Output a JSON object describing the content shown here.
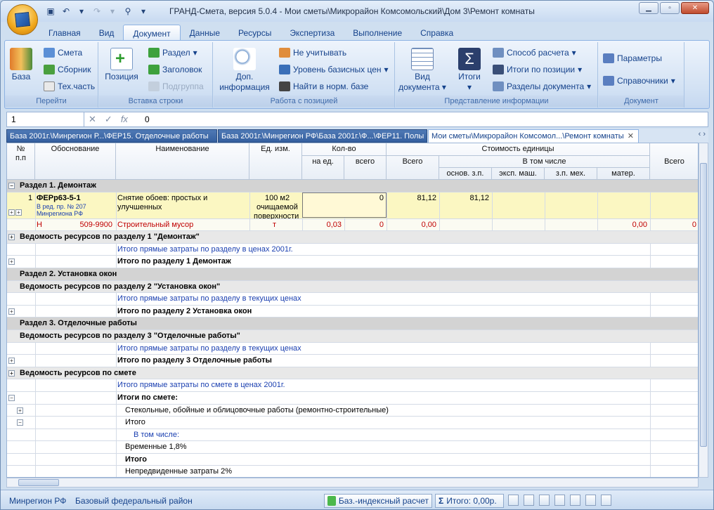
{
  "app": {
    "title": "ГРАНД-Смета, версия 5.0.4 - Мои сметы\\Микрорайон Комсомольский\\Дом 3\\Ремонт комнаты"
  },
  "ribbon_tabs": [
    "Главная",
    "Вид",
    "Документ",
    "Данные",
    "Ресурсы",
    "Экспертиза",
    "Выполнение",
    "Справка"
  ],
  "groups": {
    "go": {
      "label": "Перейти",
      "big": "База",
      "items": [
        "Смета",
        "Сборник",
        "Тех.часть"
      ]
    },
    "insert": {
      "label": "Вставка строки",
      "big": "Позиция",
      "items": [
        "Раздел",
        "Заголовок",
        "Подгруппа"
      ]
    },
    "work": {
      "label": "Работа с позицией",
      "big1": "Доп.",
      "big2": "информация",
      "items": [
        "Не учитывать",
        "Уровень базисных цен",
        "Найти в норм. базе"
      ]
    },
    "view": {
      "label": "Представление информации",
      "big1a": "Вид",
      "big1b": "документа",
      "big2": "Итоги",
      "items": [
        "Способ расчета",
        "Итоги по позиции",
        "Разделы документа"
      ]
    },
    "doc": {
      "label": "Документ",
      "items": [
        "Параметры",
        "Справочники"
      ]
    }
  },
  "formula": {
    "cell": "1",
    "value": "0"
  },
  "doc_tabs": [
    "База 2001г.\\Минрегион Р...\\ФЕР15. Отделочные работы",
    "База 2001г.\\Минрегион РФ\\База 2001г.\\Ф...\\ФЕР11. Полы",
    "Мои сметы\\Микрорайон Комсомол...\\Ремонт комнаты"
  ],
  "headers": {
    "num": "№\nп.п",
    "basis": "Обоснование",
    "name": "Наименование",
    "unit": "Ед. изм.",
    "qty": "Кол-во",
    "qty_unit": "на ед.",
    "qty_total": "всего",
    "cost": "Стоимость единицы",
    "cost_total": "Всего",
    "incl": "В том числе",
    "wage": "основ. з.п.",
    "mach": "эксп. маш.",
    "mechwage": "з.п. мех.",
    "mater": "матер.",
    "total": "Всего"
  },
  "rows": {
    "r1": "Раздел 1. Демонтаж",
    "pos_num": "1",
    "pos_code": "ФЕРр63-5-1",
    "pos_note1": "В ред. пр. № 207",
    "pos_note2": "Минрегиона РФ",
    "pos_name1": "Снятие обоев: простых и",
    "pos_name2": "улучшенных",
    "pos_unit1": "100 м2",
    "pos_unit2": "очищаемой",
    "pos_unit3": "поверхности",
    "pos_qty_total": "0",
    "pos_cost": "81,12",
    "pos_wage": "81,12",
    "res_h": "Н",
    "res_code": "509-9900",
    "res_name": "Строительный мусор",
    "res_unit": "т",
    "res_qty": "0,03",
    "res_tot": "0",
    "res_cost": "0,00",
    "res_mater": "0,00",
    "res_total": "0",
    "r3": "Ведомость ресурсов по разделу 1 \"Демонтаж\"",
    "r4": "Итого прямые затраты по разделу в ценах 2001г.",
    "r5": "Итого по разделу 1 Демонтаж",
    "r6": "Раздел 2. Установка окон",
    "r7": "Ведомость ресурсов по разделу 2 \"Установка окон\"",
    "r8": "Итого прямые затраты по разделу в текущих ценах",
    "r9": "Итого по разделу 2 Установка окон",
    "r10": "Раздел 3. Отделочные работы",
    "r11": "Ведомость ресурсов по разделу 3 \"Отделочные работы\"",
    "r12": "Итого прямые затраты по разделу в текущих ценах",
    "r13": "Итого по разделу 3 Отделочные работы",
    "r14": "Ведомость ресурсов по смете",
    "r15": "Итого прямые затраты по смете в ценах 2001г.",
    "r16": "Итоги по смете:",
    "r17": "Стекольные, обойные и облицовочные работы (ремонтно-строительные)",
    "r18": "Итого",
    "r19": "В том числе:",
    "r20": "Временные 1,8%",
    "r21": "Итого",
    "r22": "Непредвиденные затраты 2%"
  },
  "status": {
    "region": "Минрегион РФ",
    "district": "Базовый федеральный район",
    "calc": "Баз.-индексный расчет",
    "total": "Итого: 0,00р."
  }
}
